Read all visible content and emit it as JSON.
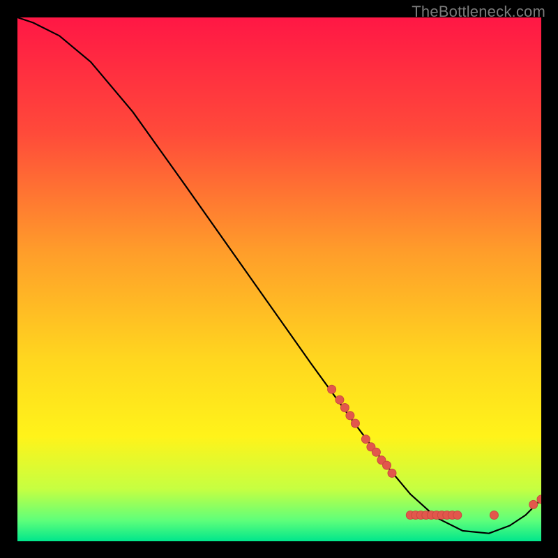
{
  "watermark": "TheBottleneck.com",
  "colors": {
    "marker_fill": "#e2574c",
    "marker_stroke": "#c94a40",
    "curve_stroke": "#000000",
    "gradient_stops": [
      {
        "offset": "0%",
        "color": "#ff1745"
      },
      {
        "offset": "22%",
        "color": "#ff4a3a"
      },
      {
        "offset": "45%",
        "color": "#ff9e2a"
      },
      {
        "offset": "65%",
        "color": "#ffd61f"
      },
      {
        "offset": "80%",
        "color": "#fff31a"
      },
      {
        "offset": "90%",
        "color": "#c6ff41"
      },
      {
        "offset": "96%",
        "color": "#5fff7a"
      },
      {
        "offset": "100%",
        "color": "#00e68c"
      }
    ]
  },
  "chart_data": {
    "type": "line",
    "title": "",
    "xlabel": "",
    "ylabel": "",
    "xlim": [
      0,
      100
    ],
    "ylim": [
      0,
      100
    ],
    "curve": [
      {
        "x": 0.0,
        "y": 100.0
      },
      {
        "x": 3.0,
        "y": 99.0
      },
      {
        "x": 8.0,
        "y": 96.5
      },
      {
        "x": 14.0,
        "y": 91.5
      },
      {
        "x": 22.0,
        "y": 82.0
      },
      {
        "x": 32.0,
        "y": 68.0
      },
      {
        "x": 44.0,
        "y": 51.0
      },
      {
        "x": 56.0,
        "y": 34.0
      },
      {
        "x": 64.0,
        "y": 23.0
      },
      {
        "x": 70.0,
        "y": 15.0
      },
      {
        "x": 75.0,
        "y": 9.0
      },
      {
        "x": 80.0,
        "y": 4.5
      },
      {
        "x": 85.0,
        "y": 2.0
      },
      {
        "x": 90.0,
        "y": 1.5
      },
      {
        "x": 94.0,
        "y": 3.0
      },
      {
        "x": 97.0,
        "y": 5.0
      },
      {
        "x": 100.0,
        "y": 8.0
      }
    ],
    "markers": [
      {
        "x": 60.0,
        "y": 29.0
      },
      {
        "x": 61.5,
        "y": 27.0
      },
      {
        "x": 62.5,
        "y": 25.5
      },
      {
        "x": 63.5,
        "y": 24.0
      },
      {
        "x": 64.5,
        "y": 22.5
      },
      {
        "x": 66.5,
        "y": 19.5
      },
      {
        "x": 67.5,
        "y": 18.0
      },
      {
        "x": 68.5,
        "y": 17.0
      },
      {
        "x": 69.5,
        "y": 15.5
      },
      {
        "x": 70.5,
        "y": 14.5
      },
      {
        "x": 71.5,
        "y": 13.0
      },
      {
        "x": 75.0,
        "y": 5.0
      },
      {
        "x": 76.0,
        "y": 5.0
      },
      {
        "x": 77.0,
        "y": 5.0
      },
      {
        "x": 78.0,
        "y": 5.0
      },
      {
        "x": 79.0,
        "y": 5.0
      },
      {
        "x": 80.0,
        "y": 5.0
      },
      {
        "x": 81.0,
        "y": 5.0
      },
      {
        "x": 82.0,
        "y": 5.0
      },
      {
        "x": 83.0,
        "y": 5.0
      },
      {
        "x": 84.0,
        "y": 5.0
      },
      {
        "x": 91.0,
        "y": 5.0
      },
      {
        "x": 98.5,
        "y": 7.0
      },
      {
        "x": 100.0,
        "y": 8.0
      }
    ]
  }
}
